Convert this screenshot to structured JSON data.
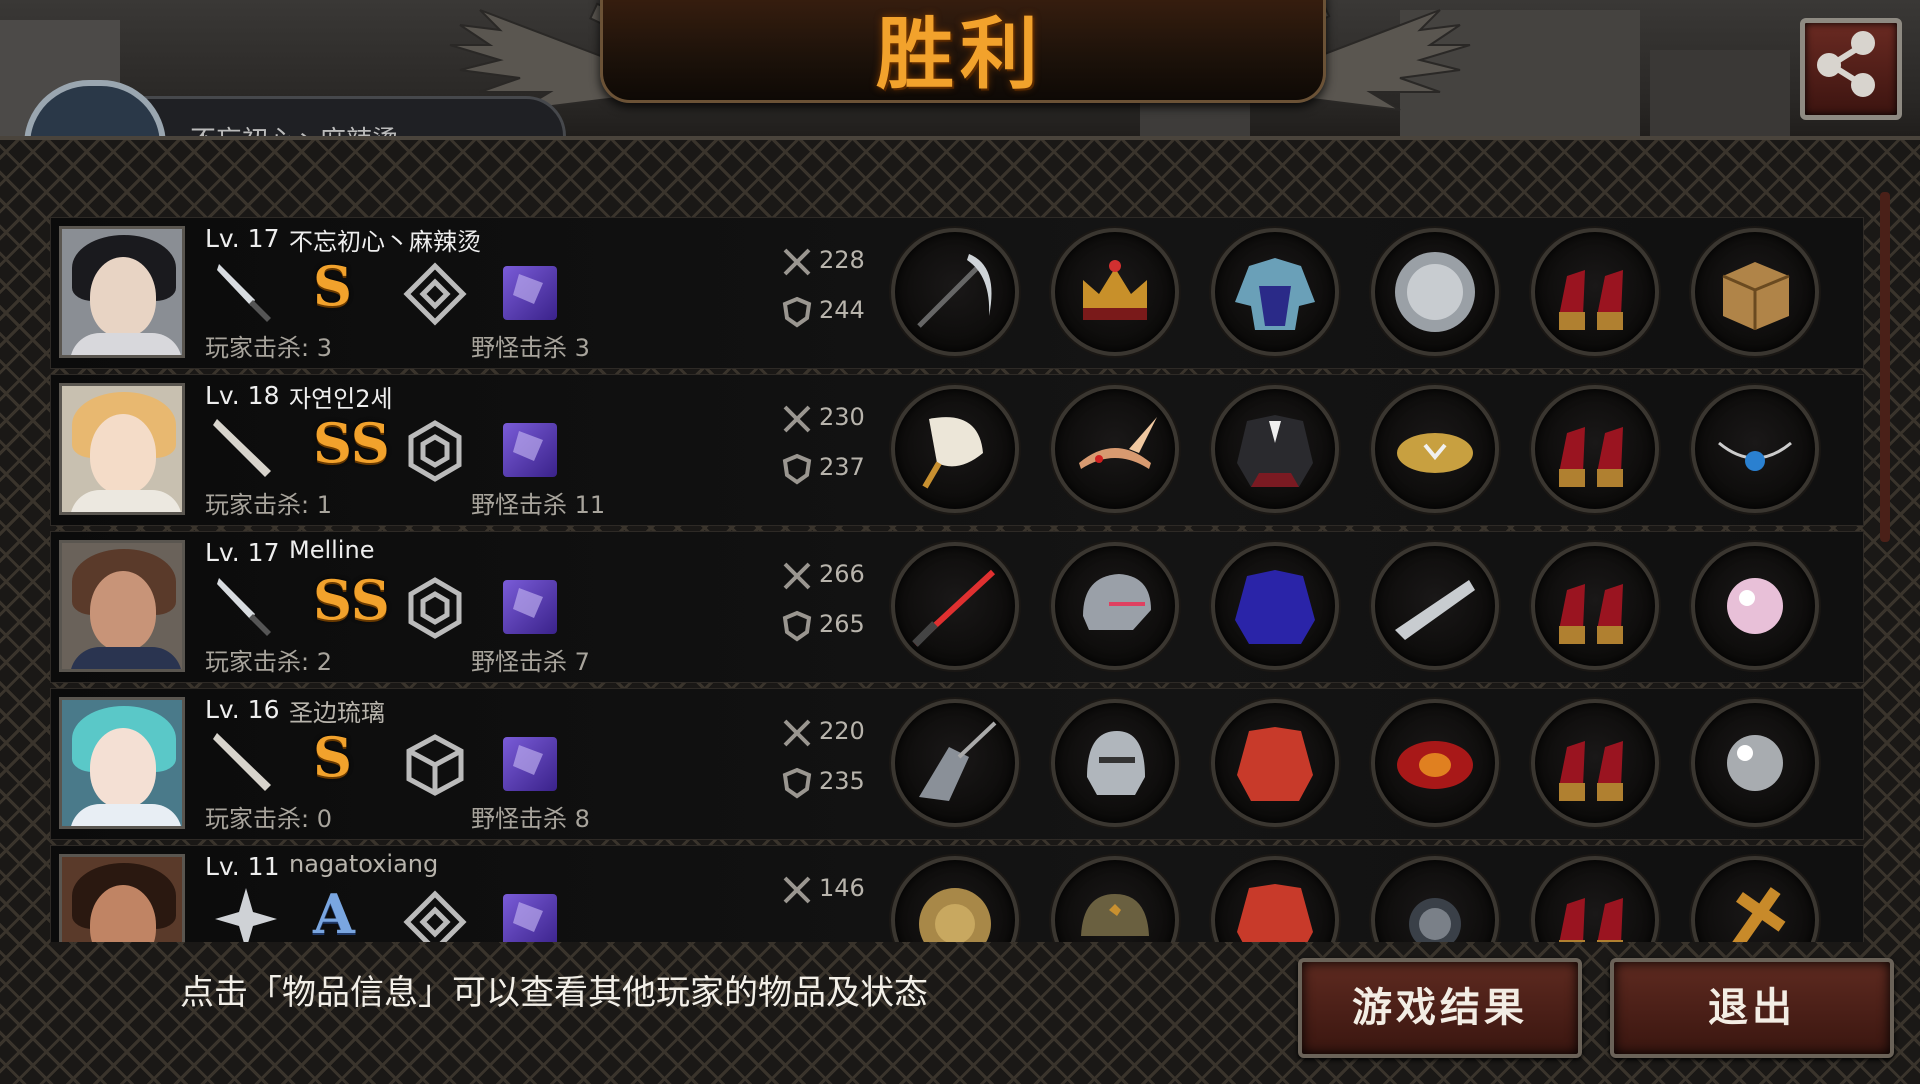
{
  "header": {
    "title": "胜利",
    "share_icon": "share-icon"
  },
  "rank_badge": {
    "name": "不忘初心丶麻辣烫"
  },
  "players": [
    {
      "level": "Lv. 17",
      "name": "不忘初心丶麻辣烫",
      "grade": "S",
      "player_kills": "玩家击杀: 3",
      "monster_kills": "野怪击杀 3",
      "attack": "228",
      "defense": "244"
    },
    {
      "level": "Lv. 18",
      "name": "자연인2세",
      "grade": "SS",
      "player_kills": "玩家击杀: 1",
      "monster_kills": "野怪击杀 11",
      "attack": "230",
      "defense": "237"
    },
    {
      "level": "Lv. 17",
      "name": "Melline",
      "grade": "SS",
      "player_kills": "玩家击杀: 2",
      "monster_kills": "野怪击杀 7",
      "attack": "266",
      "defense": "265"
    },
    {
      "level": "Lv. 16",
      "name": "圣边琉璃",
      "grade": "S",
      "player_kills": "玩家击杀: 0",
      "monster_kills": "野怪击杀 8",
      "attack": "220",
      "defense": "235"
    },
    {
      "level": "Lv. 11",
      "name": "nagatoxiang",
      "grade": "A",
      "player_kills": "",
      "monster_kills": "",
      "attack": "146",
      "defense": ""
    }
  ],
  "footer": {
    "hint": "点击「物品信息」可以查看其他玩家的物品及状态",
    "results_button": "游戏结果",
    "exit_button": "退出"
  },
  "colors": {
    "accent_gold": "#f2a22c",
    "button_red": "#5e2a20"
  }
}
